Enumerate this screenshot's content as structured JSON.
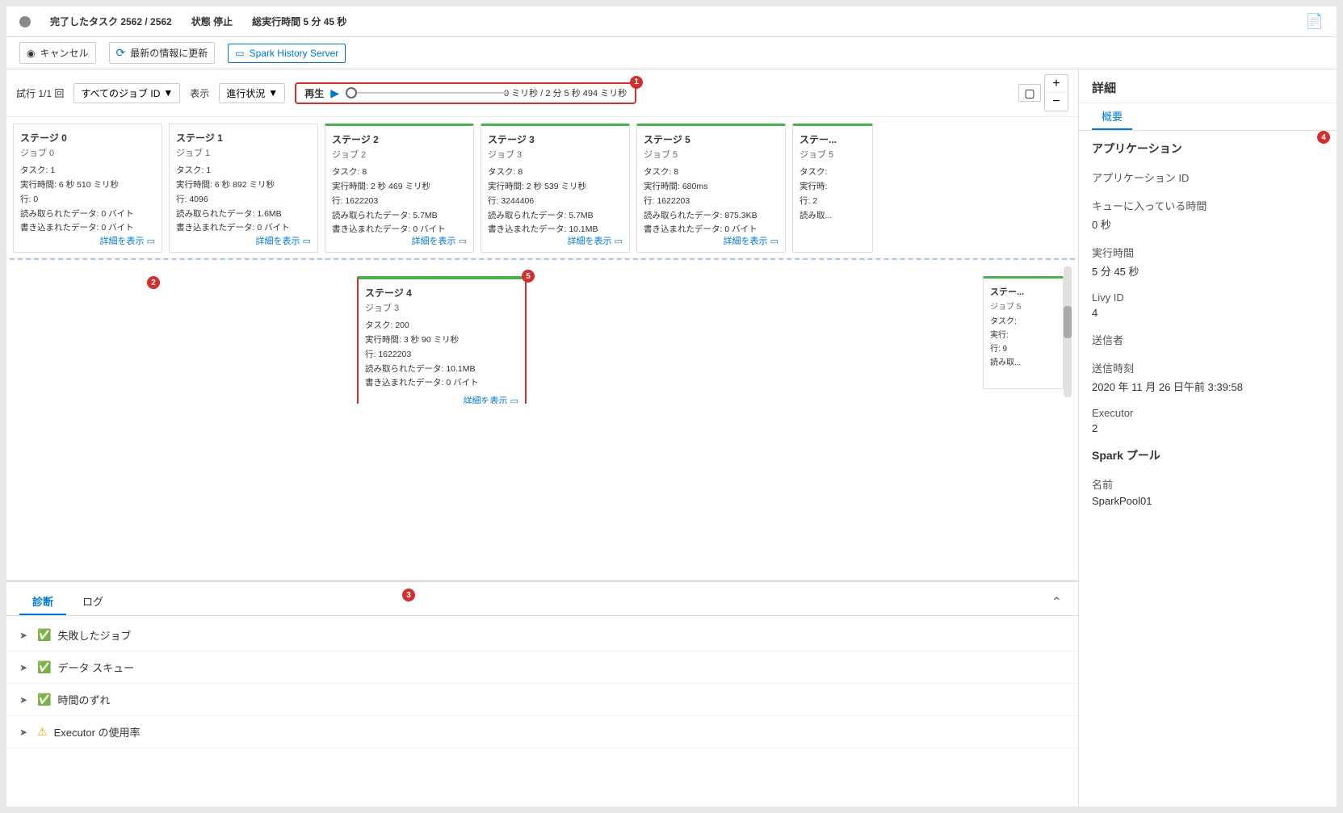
{
  "statusBar": {
    "completedTasks": "完了したタスク 2562 / 2562",
    "state": "状態 停止",
    "totalTime": "総実行時間 5 分 45 秒"
  },
  "toolbar": {
    "cancelLabel": "キャンセル",
    "refreshLabel": "最新の情報に更新",
    "sparkHistoryLabel": "Spark History Server"
  },
  "graphPanel": {
    "trialLabel": "試行 1/1 回",
    "allJobsLabel": "すべてのジョブ ID",
    "displayLabel": "表示",
    "statusLabel": "進行状況",
    "playLabel": "再生",
    "timeDisplay": "0 ミリ秒 / 2 分 5 秒 494 ミリ秒"
  },
  "stages": [
    {
      "id": "stage0",
      "title": "ステージ 0",
      "job": "ジョブ 0",
      "details": "タスク: 1\n実行時間: 6 秒 510 ミリ秒\n行: 0\n読み取られたデータ: 0 バイト\n書き込まれたデータ: 0 バイト"
    },
    {
      "id": "stage1",
      "title": "ステージ 1",
      "job": "ジョブ 1",
      "details": "タスク: 1\n実行時間: 6 秒 892 ミリ秒\n行: 4096\n読み取られたデータ: 1.6MB\n書き込まれたデータ: 0 バイト"
    },
    {
      "id": "stage2",
      "title": "ステージ 2",
      "job": "ジョブ 2",
      "details": "タスク: 8\n実行時間: 2 秒 469 ミリ秒\n行: 1622203\n読み取られたデータ: 5.7MB\n書き込まれたデータ: 0 バイト"
    },
    {
      "id": "stage3",
      "title": "ステージ 3",
      "job": "ジョブ 3",
      "details": "タスク: 8\n実行時間: 2 秒 539 ミリ秒\n行: 3244406\n読み取られたデータ: 5.7MB\n書き込まれたデータ: 10.1MB"
    },
    {
      "id": "stage5",
      "title": "ステージ 5",
      "job": "ジョブ 5",
      "details": "タスク: 8\n実行時間: 680ms\n行: 1622203\n読み取られたデータ: 875.3KB\n書き込まれたデータ: 0 バイト"
    },
    {
      "id": "stage_partial",
      "title": "ステー...",
      "job": "ジョブ 5",
      "details": "タスク:\n実行時:\n行: 2\n読み取"
    }
  ],
  "stage4": {
    "title": "ステージ 4",
    "job": "ジョブ 3",
    "details": "タスク: 200\n実行時間: 3 秒 90 ミリ秒\n行: 1622203\n読み取られたデータ: 10.1MB\n書き込まれたデータ: 0 バイト"
  },
  "stagePartialBottom": {
    "title": "ステー...",
    "job": "ジョブ 5",
    "details": "タスク:\n実行:\n行: 9\n読み取"
  },
  "diagnostics": {
    "diagTab": "診断",
    "logTab": "ログ",
    "items": [
      {
        "id": "failed-jobs",
        "label": "失敗したジョブ",
        "status": "success"
      },
      {
        "id": "data-skew",
        "label": "データ スキュー",
        "status": "success"
      },
      {
        "id": "time-skew",
        "label": "時間のずれ",
        "status": "success"
      },
      {
        "id": "executor-usage",
        "label": "Executor の使用率",
        "status": "warning"
      }
    ]
  },
  "rightPanel": {
    "title": "詳細",
    "tabs": [
      "概要"
    ],
    "sections": [
      {
        "label": "アプリケーション",
        "value": ""
      },
      {
        "label": "アプリケーション ID",
        "value": ""
      },
      {
        "label": "キューに入っている時間",
        "value": "0 秒"
      },
      {
        "label": "実行時間",
        "value": "5 分 45 秒"
      },
      {
        "label": "Livy ID",
        "value": "4"
      },
      {
        "label": "送信者",
        "value": ""
      },
      {
        "label": "送信時刻",
        "value": "2020 年 11 月 26 日午前 3:39:58"
      },
      {
        "label": "Executor",
        "value": "2"
      },
      {
        "label": "Spark プール",
        "value": ""
      },
      {
        "label": "名前",
        "value": "SparkPool01"
      }
    ]
  },
  "badges": {
    "badge1": "1",
    "badge2": "2",
    "badge3": "3",
    "badge4": "4",
    "badge5": "5"
  }
}
